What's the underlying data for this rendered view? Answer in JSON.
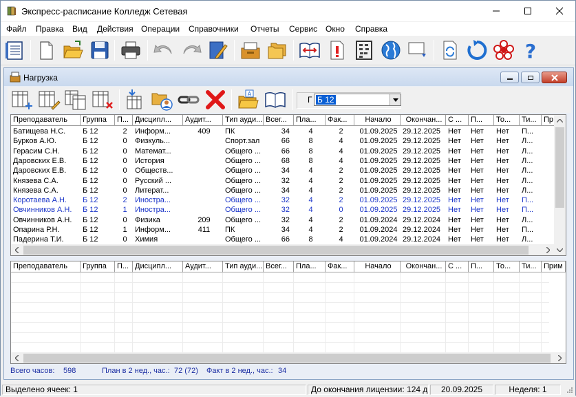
{
  "window": {
    "title": "Экспресс-расписание Колледж Сетевая"
  },
  "menu": [
    "Файл",
    "Правка",
    "Вид",
    "Действия",
    "Операции",
    "Справочники",
    "Отчеты",
    "Сервис",
    "Окно",
    "Справка"
  ],
  "child": {
    "title": "Нагрузка"
  },
  "filter": {
    "label": "Г",
    "value": "Б 12"
  },
  "columns": [
    "Преподаватель",
    "Группа",
    "П...",
    "Дисципл...",
    "Аудит...",
    "Тип ауди...",
    "Всег...",
    "Пла...",
    "Фак...",
    "Начало",
    "Окончан...",
    "С ...",
    "П...",
    "То...",
    "Ти...",
    "Пр"
  ],
  "columns_bottom_last": "Прим",
  "rows": [
    {
      "teacher": "Батищева Н.С.",
      "group": "Б 12",
      "p": "2",
      "disc": "Информ...",
      "aud": "409",
      "type": "ПК",
      "total": "34",
      "plan": "4",
      "fact": "2",
      "start": "01.09.2025",
      "end": "29.12.2025",
      "s": "Нет",
      "pp": "Нет",
      "to": "Нет",
      "ti": "П...",
      "blue": false
    },
    {
      "teacher": "Бурков А.Ю.",
      "group": "Б 12",
      "p": "0",
      "disc": "Физкуль...",
      "aud": "",
      "type": "Спорт.зал",
      "total": "66",
      "plan": "8",
      "fact": "4",
      "start": "01.09.2025",
      "end": "29.12.2025",
      "s": "Нет",
      "pp": "Нет",
      "to": "Нет",
      "ti": "Л...",
      "blue": false
    },
    {
      "teacher": "Герасим С.Н.",
      "group": "Б 12",
      "p": "0",
      "disc": "Математ...",
      "aud": "",
      "type": "Общего ...",
      "total": "66",
      "plan": "8",
      "fact": "4",
      "start": "01.09.2025",
      "end": "29.12.2025",
      "s": "Нет",
      "pp": "Нет",
      "to": "Нет",
      "ti": "Л...",
      "blue": false
    },
    {
      "teacher": "Даровских Е.В.",
      "group": "Б 12",
      "p": "0",
      "disc": "История",
      "aud": "",
      "type": "Общего ...",
      "total": "68",
      "plan": "8",
      "fact": "4",
      "start": "01.09.2025",
      "end": "29.12.2025",
      "s": "Нет",
      "pp": "Нет",
      "to": "Нет",
      "ti": "Л...",
      "blue": false
    },
    {
      "teacher": "Даровских Е.В.",
      "group": "Б 12",
      "p": "0",
      "disc": "Обществ...",
      "aud": "",
      "type": "Общего ...",
      "total": "34",
      "plan": "4",
      "fact": "2",
      "start": "01.09.2025",
      "end": "29.12.2025",
      "s": "Нет",
      "pp": "Нет",
      "to": "Нет",
      "ti": "Л...",
      "blue": false
    },
    {
      "teacher": "Князева С.А.",
      "group": "Б 12",
      "p": "0",
      "disc": "Русский ...",
      "aud": "",
      "type": "Общего ...",
      "total": "32",
      "plan": "4",
      "fact": "2",
      "start": "01.09.2025",
      "end": "29.12.2025",
      "s": "Нет",
      "pp": "Нет",
      "to": "Нет",
      "ti": "Л...",
      "blue": false
    },
    {
      "teacher": "Князева С.А.",
      "group": "Б 12",
      "p": "0",
      "disc": "Литерат...",
      "aud": "",
      "type": "Общего ...",
      "total": "34",
      "plan": "4",
      "fact": "2",
      "start": "01.09.2025",
      "end": "29.12.2025",
      "s": "Нет",
      "pp": "Нет",
      "to": "Нет",
      "ti": "Л...",
      "blue": false
    },
    {
      "teacher": "Коротаева А.Н.",
      "group": "Б 12",
      "p": "2",
      "disc": "Иностра...",
      "aud": "",
      "type": "Общего ...",
      "total": "32",
      "plan": "4",
      "fact": "2",
      "start": "01.09.2025",
      "end": "29.12.2025",
      "s": "Нет",
      "pp": "Нет",
      "to": "Нет",
      "ti": "П...",
      "blue": true
    },
    {
      "teacher": "Овчинников А.Н.",
      "group": "Б 12",
      "p": "1",
      "disc": "Иностра...",
      "aud": "",
      "type": "Общего ...",
      "total": "32",
      "plan": "4",
      "fact": "0",
      "start": "01.09.2025",
      "end": "29.12.2025",
      "s": "Нет",
      "pp": "Нет",
      "to": "Нет",
      "ti": "П...",
      "blue": true
    },
    {
      "teacher": "Овчинников А.Н.",
      "group": "Б 12",
      "p": "0",
      "disc": "Физика",
      "aud": "209",
      "type": "Общего ...",
      "total": "32",
      "plan": "4",
      "fact": "2",
      "start": "01.09.2024",
      "end": "29.12.2024",
      "s": "Нет",
      "pp": "Нет",
      "to": "Нет",
      "ti": "Л...",
      "blue": false
    },
    {
      "teacher": "Опарина Р.Н.",
      "group": "Б 12",
      "p": "1",
      "disc": "Информ...",
      "aud": "411",
      "type": "ПК",
      "total": "34",
      "plan": "4",
      "fact": "2",
      "start": "01.09.2024",
      "end": "29.12.2024",
      "s": "Нет",
      "pp": "Нет",
      "to": "Нет",
      "ti": "П...",
      "blue": false
    },
    {
      "teacher": "Падерина Т.И.",
      "group": "Б 12",
      "p": "0",
      "disc": "Химия",
      "aud": "",
      "type": "Общего ...",
      "total": "66",
      "plan": "8",
      "fact": "4",
      "start": "01.09.2024",
      "end": "29.12.2024",
      "s": "Нет",
      "pp": "Нет",
      "to": "Нет",
      "ti": "Л...",
      "blue": false
    }
  ],
  "totals": {
    "total_label": "Всего часов:",
    "total": "598",
    "plan_label": "План в 2 нед., час.:",
    "plan": "72 (72)",
    "fact_label": "Факт в 2 нед., час.:",
    "fact": "34"
  },
  "status": {
    "selected": "Выделено ячеек: 1",
    "license": "До окончания лицензии: 124 д",
    "date": "20.09.2025",
    "week": "Неделя: 1"
  }
}
